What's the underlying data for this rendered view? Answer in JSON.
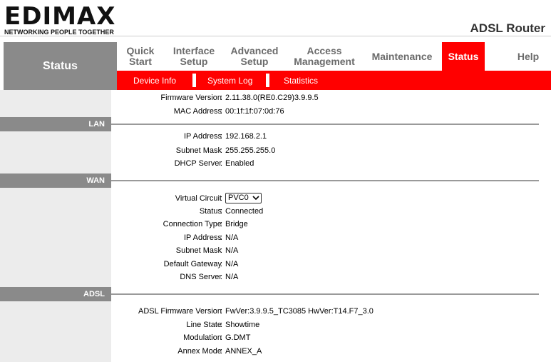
{
  "brand": {
    "logo": "EDIMAX",
    "tagline": "NETWORKING PEOPLE TOGETHER",
    "product": "ADSL Router"
  },
  "left_title": "Status",
  "menu": [
    {
      "label": "Quick\nStart",
      "id": "quick-start"
    },
    {
      "label": "Interface\nSetup",
      "id": "interface-setup"
    },
    {
      "label": "Advanced\nSetup",
      "id": "advanced-setup"
    },
    {
      "label": "Access\nManagement",
      "id": "access-management"
    },
    {
      "label": "Maintenance",
      "id": "maintenance"
    },
    {
      "label": "Status",
      "id": "status",
      "active": true
    },
    {
      "label": "Help",
      "id": "help"
    }
  ],
  "submenu": [
    "Device Info",
    "System Log",
    "Statistics"
  ],
  "device": {
    "firmware_label": "Firmware Version",
    "firmware": "2.11.38.0(RE0.C29)3.9.9.5",
    "mac_label": "MAC Address",
    "mac": "00:1f:1f:07:0d:76"
  },
  "lan": {
    "title": "LAN",
    "ip_label": "IP Address",
    "ip": "192.168.2.1",
    "mask_label": "Subnet Mask",
    "mask": "255.255.255.0",
    "dhcp_label": "DHCP Server",
    "dhcp": "Enabled"
  },
  "wan": {
    "title": "WAN",
    "vc_label": "Virtual Circuit",
    "vc": "PVC0",
    "status_label": "Status",
    "status": "Connected",
    "ctype_label": "Connection Type",
    "ctype": "Bridge",
    "ip_label": "IP Address",
    "ip": "N/A",
    "mask_label": "Subnet Mask",
    "mask": "N/A",
    "gw_label": "Default Gateway",
    "gw": "N/A",
    "dns_label": "DNS Server",
    "dns": "N/A"
  },
  "adsl": {
    "title": "ADSL",
    "fw_label": "ADSL Firmware Version",
    "fw": "FwVer:3.9.9.5_TC3085 HwVer:T14.F7_3.0",
    "line_label": "Line State",
    "line": "Showtime",
    "mod_label": "Modulation",
    "mod": "G.DMT",
    "annex_label": "Annex Mode",
    "annex": "ANNEX_A"
  },
  "colors": {
    "accent": "#ff0000",
    "gray": "#8a8a8a"
  }
}
